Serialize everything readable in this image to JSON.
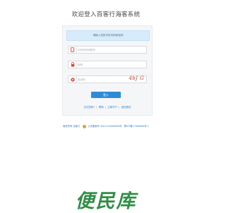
{
  "title": "欢迎登入百客行海客系统",
  "notice": "请输入您的手机号码和密码",
  "fields": {
    "phone_placeholder": "手机号码或账号",
    "password_placeholder": "密码",
    "captcha_placeholder": "验证码",
    "captcha_text": "4bJ G"
  },
  "login_label": "登入",
  "links": {
    "forgot": "忘记密码?",
    "sep1": "|",
    "help": "帮助",
    "sep2": "|",
    "register": "立即开户",
    "sep3": "|",
    "home": "返回首页"
  },
  "footer": {
    "company": "版权所有 百客行",
    "record": "公安备案号 4201110000000号",
    "icp": "鄂ICP备17000000号-1"
  },
  "watermark": "便民库",
  "colors": {
    "accent": "#2f8bd6",
    "notice_bg": "#d7ebfb",
    "captcha": "#d03a2c",
    "watermark": "#2f8f45"
  }
}
